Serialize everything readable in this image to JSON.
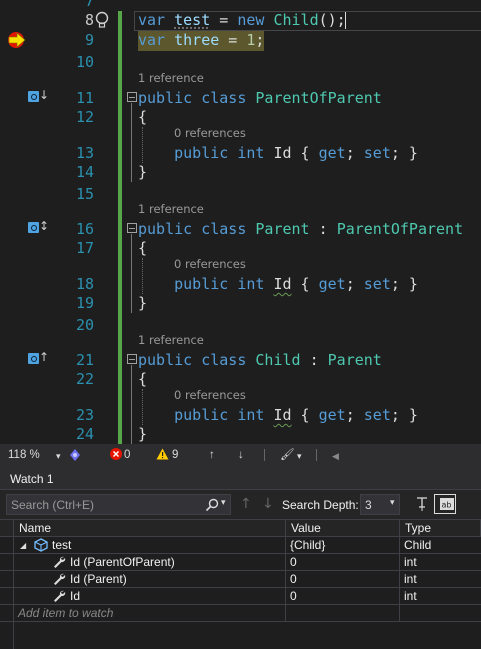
{
  "editor": {
    "lines": [
      {
        "num": "7"
      },
      {
        "num": "8",
        "code": [
          {
            "t": "var",
            "c": "kw"
          },
          {
            "t": " "
          },
          {
            "t": "test",
            "c": "id dotted"
          },
          {
            "t": " = "
          },
          {
            "t": "new",
            "c": "kw"
          },
          {
            "t": " "
          },
          {
            "t": "Child",
            "c": "ty"
          },
          {
            "t": "();"
          }
        ]
      },
      {
        "num": "9",
        "code": [
          {
            "t": "var",
            "c": "kw"
          },
          {
            "t": " "
          },
          {
            "t": "three",
            "c": "id"
          },
          {
            "t": " = "
          },
          {
            "t": "1",
            "c": "num"
          },
          {
            "t": ";"
          }
        ]
      },
      {
        "num": "10"
      },
      {
        "num": "11",
        "lens": "1 reference",
        "code": [
          {
            "t": "public",
            "c": "kw"
          },
          {
            "t": " "
          },
          {
            "t": "class",
            "c": "kw"
          },
          {
            "t": " "
          },
          {
            "t": "ParentOfParent",
            "c": "ty"
          }
        ]
      },
      {
        "num": "12",
        "code": [
          {
            "t": "{"
          }
        ]
      },
      {
        "num": "13",
        "lens": "0 references",
        "code": [
          {
            "t": "    "
          },
          {
            "t": "public",
            "c": "kw"
          },
          {
            "t": " "
          },
          {
            "t": "int",
            "c": "kw"
          },
          {
            "t": " Id { "
          },
          {
            "t": "get",
            "c": "kw"
          },
          {
            "t": "; "
          },
          {
            "t": "set",
            "c": "kw"
          },
          {
            "t": "; }"
          }
        ]
      },
      {
        "num": "14",
        "code": [
          {
            "t": "}"
          }
        ]
      },
      {
        "num": "15"
      },
      {
        "num": "16",
        "lens": "1 reference",
        "code": [
          {
            "t": "public",
            "c": "kw"
          },
          {
            "t": " "
          },
          {
            "t": "class",
            "c": "kw"
          },
          {
            "t": " "
          },
          {
            "t": "Parent",
            "c": "ty"
          },
          {
            "t": " : "
          },
          {
            "t": "ParentOfParent",
            "c": "ty"
          }
        ]
      },
      {
        "num": "17",
        "code": [
          {
            "t": "{"
          }
        ]
      },
      {
        "num": "18",
        "lens": "0 references",
        "code": [
          {
            "t": "    "
          },
          {
            "t": "public",
            "c": "kw"
          },
          {
            "t": " "
          },
          {
            "t": "int",
            "c": "kw"
          },
          {
            "t": " "
          },
          {
            "t": "Id",
            "c": "wavy"
          },
          {
            "t": " { "
          },
          {
            "t": "get",
            "c": "kw"
          },
          {
            "t": "; "
          },
          {
            "t": "set",
            "c": "kw"
          },
          {
            "t": "; }"
          }
        ]
      },
      {
        "num": "19",
        "code": [
          {
            "t": "}"
          }
        ]
      },
      {
        "num": "20"
      },
      {
        "num": "21",
        "lens": "1 reference",
        "code": [
          {
            "t": "public",
            "c": "kw"
          },
          {
            "t": " "
          },
          {
            "t": "class",
            "c": "kw"
          },
          {
            "t": " "
          },
          {
            "t": "Child",
            "c": "ty"
          },
          {
            "t": " : "
          },
          {
            "t": "Parent",
            "c": "ty"
          }
        ]
      },
      {
        "num": "22",
        "code": [
          {
            "t": "{"
          }
        ]
      },
      {
        "num": "23",
        "lens": "0 references",
        "code": [
          {
            "t": "    "
          },
          {
            "t": "public",
            "c": "kw"
          },
          {
            "t": " "
          },
          {
            "t": "int",
            "c": "kw"
          },
          {
            "t": " "
          },
          {
            "t": "Id",
            "c": "wavy"
          },
          {
            "t": " { "
          },
          {
            "t": "get",
            "c": "kw"
          },
          {
            "t": "; "
          },
          {
            "t": "set",
            "c": "kw"
          },
          {
            "t": "; }"
          }
        ]
      },
      {
        "num": "24",
        "code": [
          {
            "t": "}"
          }
        ]
      }
    ],
    "inherit_arrows": {
      "r11": "↓",
      "r16": "↕",
      "r21": "↑"
    }
  },
  "status": {
    "zoom": "118 %",
    "errors": "0",
    "warnings": "9"
  },
  "watch": {
    "title": "Watch 1",
    "search_placeholder": "Search (Ctrl+E)",
    "depth_label": "Search Depth:",
    "depth_value": "3",
    "columns": {
      "name": "Name",
      "value": "Value",
      "type": "Type"
    },
    "rows": [
      {
        "name": "test",
        "value": "{Child}",
        "type": "Child"
      },
      {
        "name": "Id (ParentOfParent)",
        "value": "0",
        "type": "int"
      },
      {
        "name": "Id (Parent)",
        "value": "0",
        "type": "int"
      },
      {
        "name": "Id",
        "value": "0",
        "type": "int"
      }
    ],
    "add_placeholder": "Add item to watch"
  }
}
